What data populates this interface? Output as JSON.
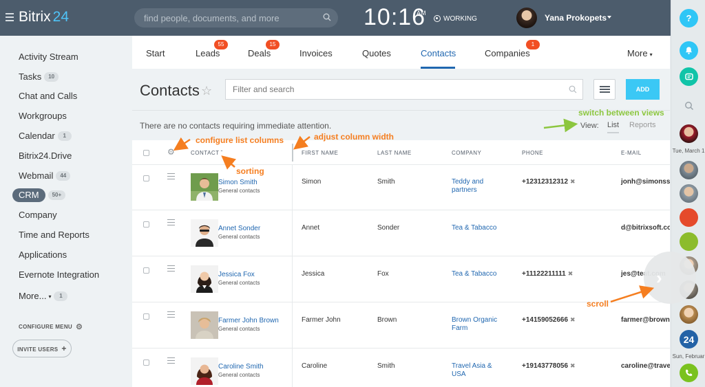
{
  "header": {
    "logo_text": "Bitrix",
    "logo_num": "24",
    "search_placeholder": "find people, documents, and more",
    "clock": "10:16",
    "ampm": "AM",
    "status": "WORKING",
    "user_name": "Yana Prokopets"
  },
  "sidebar": {
    "items": [
      {
        "label": "Activity Stream",
        "badge": ""
      },
      {
        "label": "Tasks",
        "badge": "10"
      },
      {
        "label": "Chat and Calls",
        "badge": ""
      },
      {
        "label": "Workgroups",
        "badge": ""
      },
      {
        "label": "Calendar",
        "badge": "1"
      },
      {
        "label": "Bitrix24.Drive",
        "badge": ""
      },
      {
        "label": "Webmail",
        "badge": "44"
      },
      {
        "label": "CRM",
        "badge": "50+"
      },
      {
        "label": "Company",
        "badge": ""
      },
      {
        "label": "Time and Reports",
        "badge": ""
      },
      {
        "label": "Applications",
        "badge": ""
      },
      {
        "label": "Evernote Integration",
        "badge": ""
      },
      {
        "label": "More...",
        "badge": "1"
      }
    ],
    "configure_menu": "CONFIGURE MENU",
    "invite_users": "INVITE USERS"
  },
  "tabs": [
    {
      "label": "Start",
      "badge": ""
    },
    {
      "label": "Leads",
      "badge": "55"
    },
    {
      "label": "Deals",
      "badge": "15"
    },
    {
      "label": "Invoices",
      "badge": ""
    },
    {
      "label": "Quotes",
      "badge": ""
    },
    {
      "label": "Contacts",
      "badge": ""
    },
    {
      "label": "Companies",
      "badge": "1"
    },
    {
      "label": "More",
      "badge": ""
    }
  ],
  "page": {
    "title": "Contacts",
    "filter_placeholder": "Filter and search",
    "add_label": "ADD",
    "notice": "There are no contacts requiring immediate attention.",
    "view_label": "View:",
    "view_list": "List",
    "view_reports": "Reports"
  },
  "table": {
    "columns": [
      "CONTACT",
      "FIRST NAME",
      "LAST NAME",
      "COMPANY",
      "PHONE",
      "E-MAIL"
    ],
    "rows": [
      {
        "name": "Simon Smith",
        "type": "General contacts",
        "first": "Simon",
        "last": "Smith",
        "company": "Teddy and partners",
        "phone": "+12312312312",
        "email": "jonh@simonss"
      },
      {
        "name": "Annet Sonder",
        "type": "General contacts",
        "first": "Annet",
        "last": "Sonder",
        "company": "Tea & Tabacco",
        "phone": "",
        "email": "d@bitrixsoft.co"
      },
      {
        "name": "Jessica Fox",
        "type": "General contacts",
        "first": "Jessica",
        "last": "Fox",
        "company": "Tea & Tabacco",
        "phone": "+11122211111",
        "email": "jes@teat.com"
      },
      {
        "name": "Farmer John Brown",
        "type": "General contacts",
        "first": "Farmer John",
        "last": "Brown",
        "company": "Brown Organic Farm",
        "phone": "+14159052666",
        "email": "farmer@brown"
      },
      {
        "name": "Caroline Smith",
        "type": "General contacts",
        "first": "Caroline",
        "last": "Smith",
        "company": "Travel Asia & USA",
        "phone": "+19143778056",
        "email": "caroline@trave"
      }
    ]
  },
  "rail": {
    "help": "?",
    "date_top": "Tue, March 1",
    "date_bottom": "Sun, Februar",
    "b24": "24"
  },
  "annotations": {
    "configure_columns": "configure list columns",
    "adjust_width": "adjust column width",
    "sorting": "sorting",
    "switch_views": "switch between views",
    "scroll": "scroll"
  },
  "colors": {
    "topbar": "#4c5c6c",
    "accent_blue": "#2067b0",
    "add_button": "#3bc8f5",
    "badge_red": "#f14f24",
    "annotation_orange": "#f57e20",
    "annotation_green": "#8cc63f"
  }
}
